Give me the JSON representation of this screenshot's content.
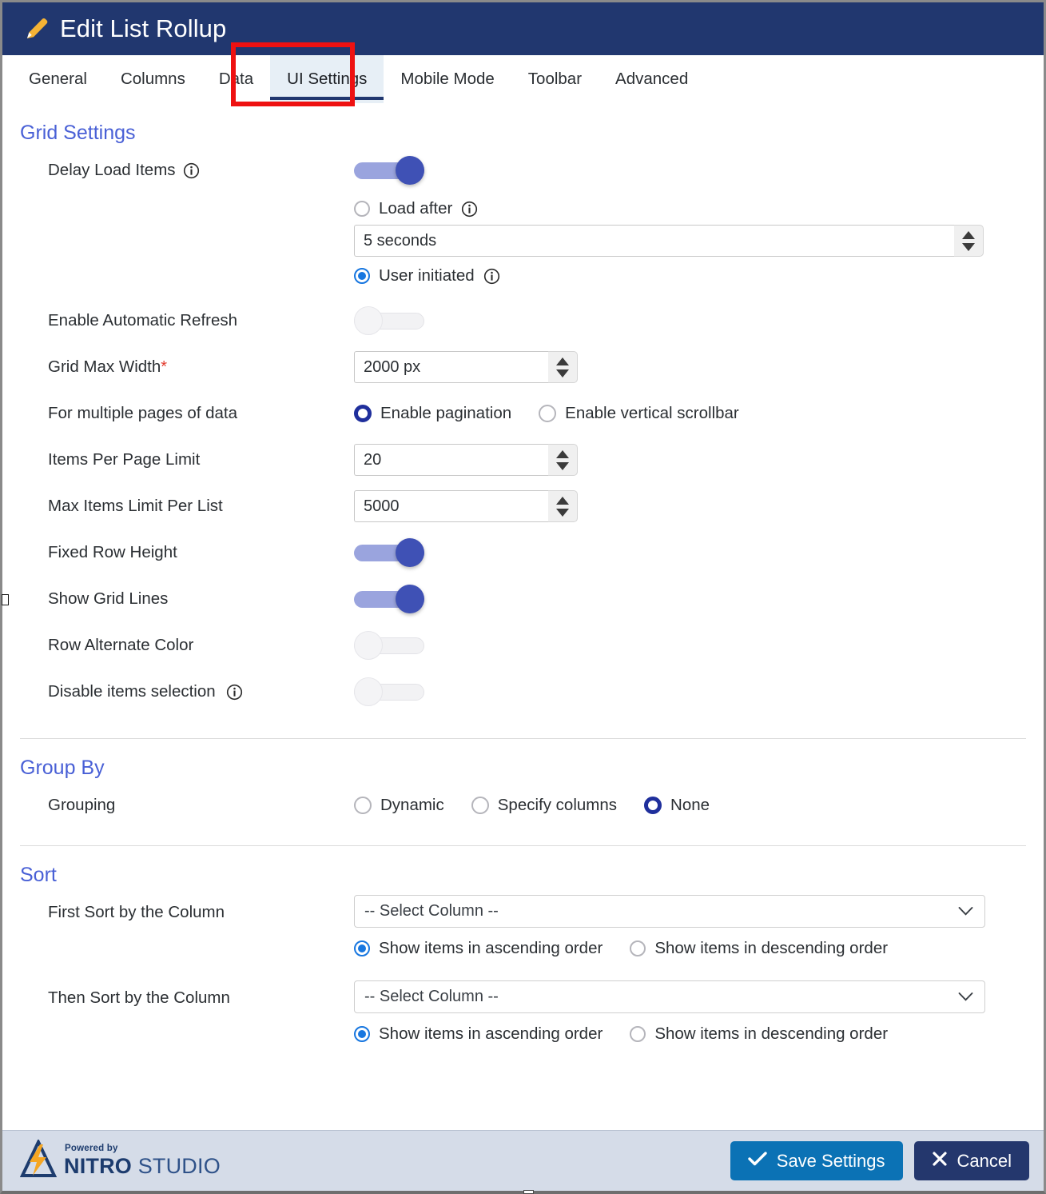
{
  "header": {
    "title": "Edit List Rollup",
    "icon": "pencil-icon",
    "bg_color": "#21376f"
  },
  "tabs": [
    {
      "label": "General",
      "active": false
    },
    {
      "label": "Columns",
      "active": false
    },
    {
      "label": "Data",
      "active": false
    },
    {
      "label": "UI Settings",
      "active": true
    },
    {
      "label": "Mobile Mode",
      "active": false
    },
    {
      "label": "Toolbar",
      "active": false
    },
    {
      "label": "Advanced",
      "active": false
    }
  ],
  "annotation": {
    "type": "rectangle",
    "color": "#ee1111",
    "target": "UI Settings tab"
  },
  "grid_settings": {
    "title": "Grid Settings",
    "delay_load_items": {
      "label": "Delay Load Items",
      "has_info": true,
      "toggle_state": "on",
      "load_after": {
        "label": "Load after",
        "has_info": true,
        "selected": false,
        "value": "5 seconds"
      },
      "user_initiated": {
        "label": "User initiated",
        "has_info": true,
        "selected": true
      }
    },
    "enable_automatic_refresh": {
      "label": "Enable Automatic Refresh",
      "toggle_state": "off"
    },
    "grid_max_width": {
      "label": "Grid Max Width",
      "required": true,
      "required_marker": "*",
      "value": "2000 px"
    },
    "multiple_pages": {
      "label": "For multiple pages of data",
      "options": [
        {
          "label": "Enable pagination",
          "selected": true
        },
        {
          "label": "Enable vertical scrollbar",
          "selected": false
        }
      ]
    },
    "items_per_page_limit": {
      "label": "Items Per Page Limit",
      "value": "20"
    },
    "max_items_limit": {
      "label": "Max Items Limit Per List",
      "value": "5000"
    },
    "fixed_row_height": {
      "label": "Fixed Row Height",
      "toggle_state": "on"
    },
    "show_grid_lines": {
      "label": "Show Grid Lines",
      "toggle_state": "on"
    },
    "row_alternate_color": {
      "label": "Row Alternate Color",
      "toggle_state": "off"
    },
    "disable_items_selection": {
      "label": "Disable items selection",
      "has_info": true,
      "toggle_state": "off"
    }
  },
  "group_by": {
    "title": "Group By",
    "grouping": {
      "label": "Grouping",
      "options": [
        {
          "label": "Dynamic",
          "selected": false
        },
        {
          "label": "Specify columns",
          "selected": false
        },
        {
          "label": "None",
          "selected": true
        }
      ]
    }
  },
  "sort": {
    "title": "Sort",
    "first": {
      "label": "First Sort by the Column",
      "select_value": "-- Select Column --",
      "order_options": [
        {
          "label": "Show items in ascending order",
          "selected": true
        },
        {
          "label": "Show items in descending order",
          "selected": false
        }
      ]
    },
    "then": {
      "label": "Then Sort by the Column",
      "select_value": "-- Select Column --",
      "order_options": [
        {
          "label": "Show items in ascending order",
          "selected": true
        },
        {
          "label": "Show items in descending order",
          "selected": false
        }
      ]
    }
  },
  "footer": {
    "logo": {
      "powered_by": "Powered by",
      "brand_bold": "NITRO",
      "brand_light": " STUDIO"
    },
    "save_label": "Save Settings",
    "cancel_label": "Cancel",
    "save_color": "#0b72b5",
    "cancel_color": "#24376d"
  }
}
